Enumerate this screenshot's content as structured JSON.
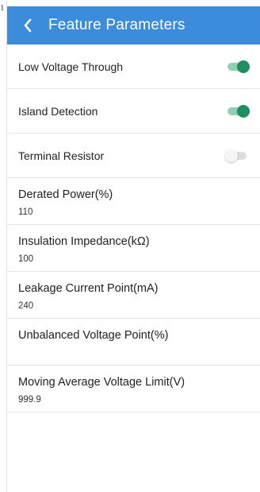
{
  "stray_text": "1",
  "header": {
    "title": "Feature Parameters",
    "back_icon": "chevron-left-icon"
  },
  "colors": {
    "header": "#3b8ddb",
    "toggle_on": "#1f8f63",
    "toggle_on_track": "#8fd0b3",
    "toggle_off_track": "#dddddd"
  },
  "toggles": [
    {
      "label": "Low Voltage Through",
      "state": "on"
    },
    {
      "label": "Island Detection",
      "state": "on"
    },
    {
      "label": "Terminal Resistor",
      "state": "off"
    }
  ],
  "settings": [
    {
      "label": "Derated Power(%)",
      "value": "110"
    },
    {
      "label": "Insulation Impedance(kΩ)",
      "value": "100"
    },
    {
      "label": "Leakage Current Point(mA)",
      "value": "240"
    },
    {
      "label": "Unbalanced Voltage Point(%)",
      "value": ""
    },
    {
      "label": "Moving Average Voltage Limit(V)",
      "value": "999.9"
    }
  ]
}
